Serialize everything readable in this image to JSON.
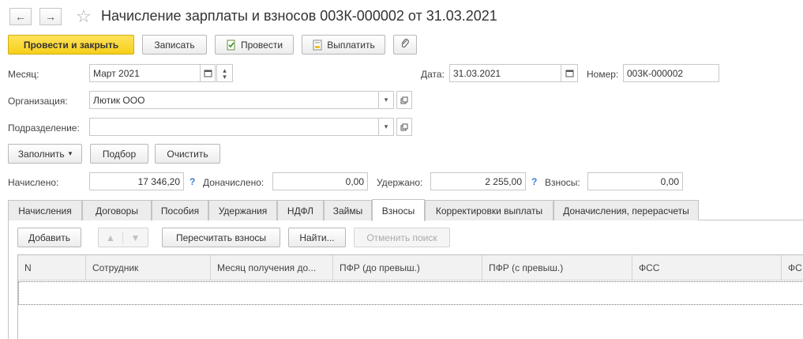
{
  "window": {
    "title": "Начисление зарплаты и взносов 003К-000002 от 31.03.2021",
    "back_icon": "←",
    "forward_icon": "→",
    "star_icon": "☆"
  },
  "toolbar": {
    "post_close": "Провести и закрыть",
    "save": "Записать",
    "post": "Провести",
    "pay": "Выплатить",
    "attach_icon": "paperclip-icon"
  },
  "form": {
    "month_label": "Месяц:",
    "month_value": "Март 2021",
    "date_label": "Дата:",
    "date_value": "31.03.2021",
    "number_label": "Номер:",
    "number_value": "003К-000002",
    "org_label": "Организация:",
    "org_value": "Лютик ООО",
    "dept_label": "Подразделение:",
    "dept_value": ""
  },
  "actions": {
    "fill": "Заполнить",
    "select": "Подбор",
    "clear": "Очистить"
  },
  "totals": {
    "accrued_label": "Начислено:",
    "accrued_value": "17 346,20",
    "extra_label": "Доначислено:",
    "extra_value": "0,00",
    "withheld_label": "Удержано:",
    "withheld_value": "2 255,00",
    "contrib_label": "Взносы:",
    "contrib_value": "0,00",
    "help_mark": "?"
  },
  "tabs": [
    {
      "label": "Начисления"
    },
    {
      "label": "Договоры"
    },
    {
      "label": "Пособия"
    },
    {
      "label": "Удержания"
    },
    {
      "label": "НДФЛ"
    },
    {
      "label": "Займы"
    },
    {
      "label": "Взносы",
      "active": true
    },
    {
      "label": "Корректировки выплаты"
    },
    {
      "label": "Доначисления, перерасчеты"
    }
  ],
  "table_toolbar": {
    "add": "Добавить",
    "recalc": "Пересчитать взносы",
    "find": "Найти...",
    "cancel_search": "Отменить поиск"
  },
  "table": {
    "columns": [
      "N",
      "Сотрудник",
      "Месяц получения до...",
      "ПФР (до превыш.)",
      "ПФР (с превыш.)",
      "ФСС",
      "ФС"
    ]
  },
  "colors": {
    "primary_button": "#f6cf1b",
    "help_mark": "#3b7bd1"
  }
}
